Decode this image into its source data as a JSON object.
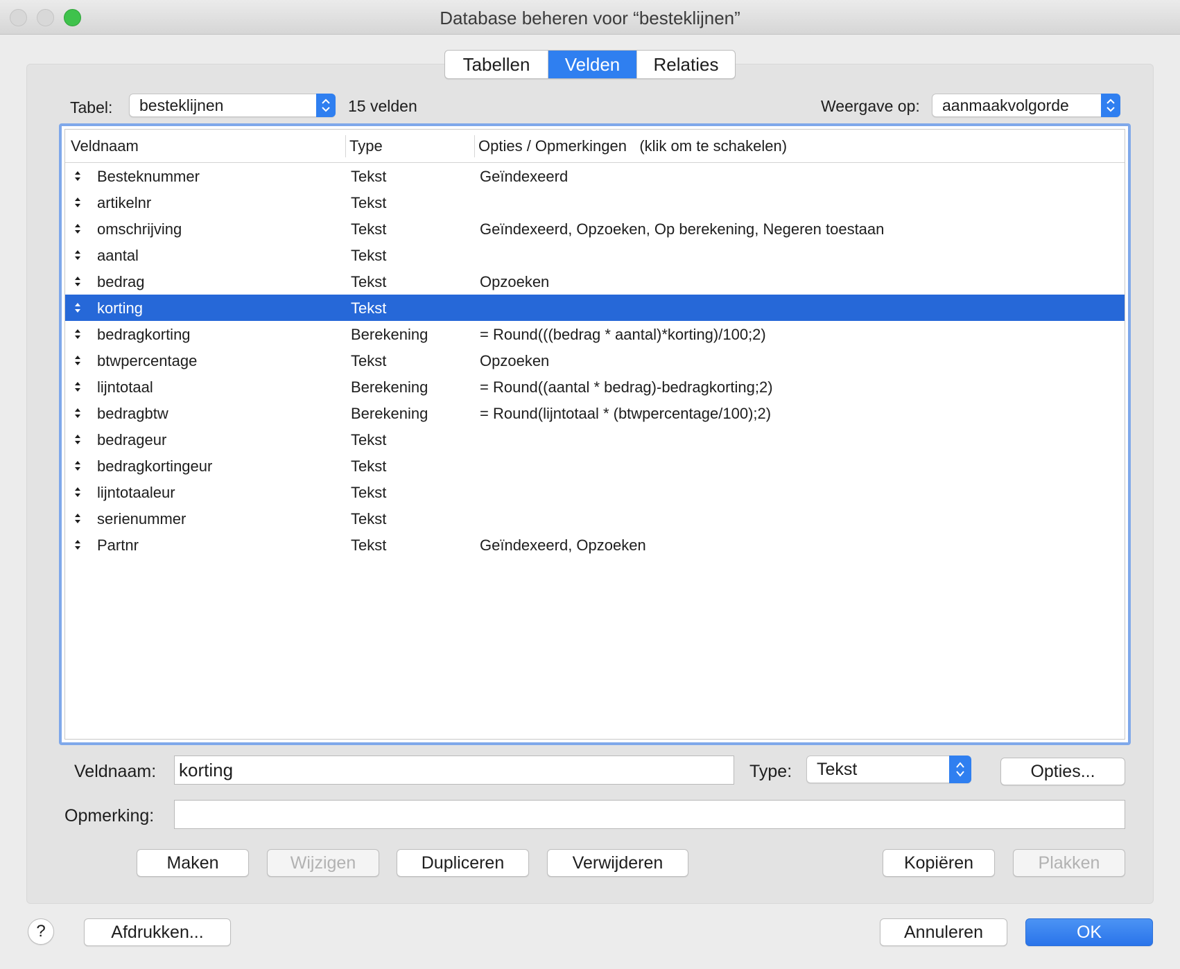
{
  "window": {
    "title": "Database beheren voor “besteklijnen”"
  },
  "tabs": [
    {
      "label": "Tabellen",
      "active": false
    },
    {
      "label": "Velden",
      "active": true
    },
    {
      "label": "Relaties",
      "active": false
    }
  ],
  "toolbar": {
    "table_label": "Tabel:",
    "table_value": "besteklijnen",
    "field_count": "15 velden",
    "view_label": "Weergave op:",
    "view_value": "aanmaakvolgorde"
  },
  "list": {
    "columns": [
      "Veldnaam",
      "Type",
      "Opties / Opmerkingen   (klik om te schakelen)"
    ],
    "rows": [
      {
        "name": "Besteknummer",
        "type": "Tekst",
        "options": "Geïndexeerd"
      },
      {
        "name": "artikelnr",
        "type": "Tekst",
        "options": ""
      },
      {
        "name": "omschrijving",
        "type": "Tekst",
        "options": "Geïndexeerd, Opzoeken, Op berekening, Negeren toestaan"
      },
      {
        "name": "aantal",
        "type": "Tekst",
        "options": ""
      },
      {
        "name": "bedrag",
        "type": "Tekst",
        "options": "Opzoeken"
      },
      {
        "name": "korting",
        "type": "Tekst",
        "options": ""
      },
      {
        "name": "bedragkorting",
        "type": "Berekening",
        "options": "= Round(((bedrag * aantal)*korting)/100;2)"
      },
      {
        "name": "btwpercentage",
        "type": "Tekst",
        "options": "Opzoeken"
      },
      {
        "name": "lijntotaal",
        "type": "Berekening",
        "options": "= Round((aantal * bedrag)-bedragkorting;2)"
      },
      {
        "name": "bedragbtw",
        "type": "Berekening",
        "options": "= Round(lijntotaal * (btwpercentage/100);2)"
      },
      {
        "name": "bedrageur",
        "type": "Tekst",
        "options": ""
      },
      {
        "name": "bedragkortingeur",
        "type": "Tekst",
        "options": ""
      },
      {
        "name": "lijntotaaleur",
        "type": "Tekst",
        "options": ""
      },
      {
        "name": "serienummer",
        "type": "Tekst",
        "options": ""
      },
      {
        "name": "Partnr",
        "type": "Tekst",
        "options": "Geïndexeerd, Opzoeken"
      }
    ],
    "selected_index": 5
  },
  "form": {
    "fieldname_label": "Veldnaam:",
    "fieldname_value": "korting",
    "type_label": "Type:",
    "type_value": "Tekst",
    "options_button": "Opties...",
    "comment_label": "Opmerking:",
    "comment_value": ""
  },
  "actions": {
    "create": "Maken",
    "change": "Wijzigen",
    "duplicate": "Dupliceren",
    "delete": "Verwijderen",
    "copy": "Kopiëren",
    "paste": "Plakken"
  },
  "footer": {
    "help": "?",
    "print": "Afdrukken...",
    "cancel": "Annuleren",
    "ok": "OK"
  },
  "colors": {
    "accent": "#2f7ff0",
    "selection": "#2668d8",
    "focus_ring": "#7fa8ea"
  }
}
